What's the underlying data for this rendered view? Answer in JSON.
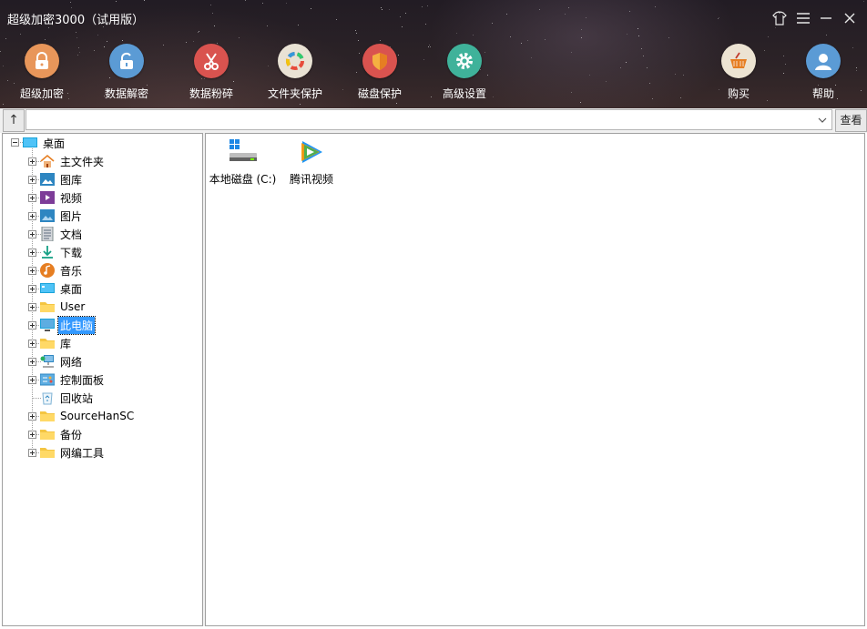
{
  "window": {
    "title": "超级加密3000（试用版）"
  },
  "toolbar": {
    "items": [
      {
        "label": "超级加密",
        "icon": "lock-icon",
        "color": "#e8965a"
      },
      {
        "label": "数据解密",
        "icon": "unlock-icon",
        "color": "#5b9bd5"
      },
      {
        "label": "数据粉碎",
        "icon": "scissors-icon",
        "color": "#d9534f"
      },
      {
        "label": "文件夹保护",
        "icon": "folder-protect-icon",
        "color": "#e9e2d4"
      },
      {
        "label": "磁盘保护",
        "icon": "shield-icon",
        "color": "#d9534f"
      },
      {
        "label": "高级设置",
        "icon": "gear-icon",
        "color": "#3fb29a"
      }
    ],
    "right_items": [
      {
        "label": "购买",
        "icon": "basket-icon",
        "color": "#ece3d2"
      },
      {
        "label": "帮助",
        "icon": "user-icon",
        "color": "#5b9bd5"
      }
    ]
  },
  "addressbar": {
    "up_label": "↑",
    "path_value": "",
    "view_button": "查看"
  },
  "tree": {
    "root": "桌面",
    "items": [
      {
        "label": "主文件夹",
        "icon": "home-icon",
        "expandable": true
      },
      {
        "label": "图库",
        "icon": "gallery-icon",
        "expandable": true
      },
      {
        "label": "视频",
        "icon": "video-icon",
        "expandable": true
      },
      {
        "label": "图片",
        "icon": "picture-icon",
        "expandable": true
      },
      {
        "label": "文档",
        "icon": "document-icon",
        "expandable": true
      },
      {
        "label": "下载",
        "icon": "download-icon",
        "expandable": true
      },
      {
        "label": "音乐",
        "icon": "music-icon",
        "expandable": true
      },
      {
        "label": "桌面",
        "icon": "desktop-icon",
        "expandable": true
      },
      {
        "label": "User",
        "icon": "folder-icon",
        "expandable": true
      },
      {
        "label": "此电脑",
        "icon": "computer-icon",
        "expandable": true,
        "selected": true
      },
      {
        "label": "库",
        "icon": "folder-icon",
        "expandable": true
      },
      {
        "label": "网络",
        "icon": "network-icon",
        "expandable": true
      },
      {
        "label": "控制面板",
        "icon": "control-panel-icon",
        "expandable": true
      },
      {
        "label": "回收站",
        "icon": "recycle-bin-icon",
        "expandable": false
      },
      {
        "label": "SourceHanSC",
        "icon": "folder-icon",
        "expandable": true
      },
      {
        "label": "备份",
        "icon": "folder-icon",
        "expandable": true
      },
      {
        "label": "网编工具",
        "icon": "folder-icon",
        "expandable": true
      }
    ]
  },
  "content": {
    "items": [
      {
        "label": "本地磁盘 (C:)",
        "icon": "drive-icon"
      },
      {
        "label": "腾讯视频",
        "icon": "tencent-video-icon"
      }
    ]
  }
}
